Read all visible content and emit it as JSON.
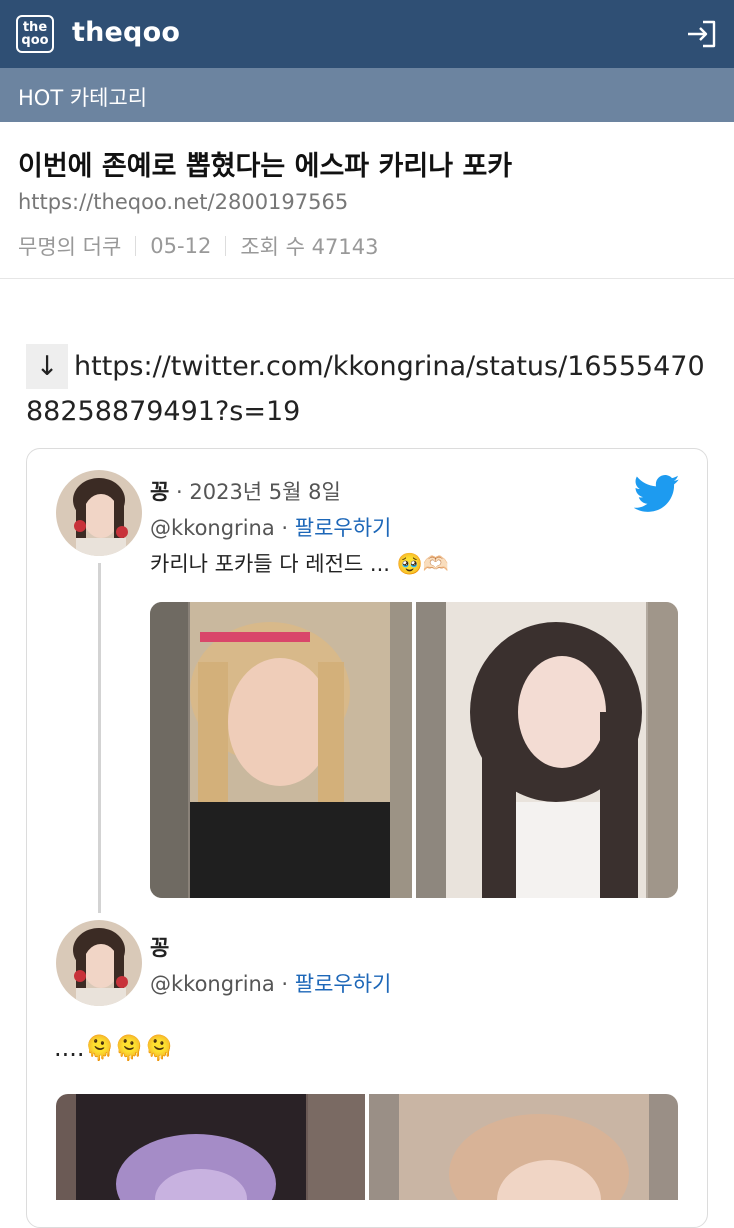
{
  "header": {
    "logo_top": "the",
    "logo_bottom": "qoo",
    "brand": "theqoo"
  },
  "category": {
    "label": "HOT 카테고리"
  },
  "post": {
    "title": "이번에 존예로 뽑혔다는 에스파 카리나 포카",
    "url": "https://theqoo.net/2800197565",
    "author": "무명의 더쿠",
    "date": "05-12",
    "views": "조회 수 47143"
  },
  "content": {
    "arrow": "↓",
    "link": "https://twitter.com/kkongrina/status/1655547088258879491?s=19"
  },
  "tweets": [
    {
      "name": "꽁",
      "date": "· 2023년 5월 8일",
      "handle": "@kkongrina",
      "dot": "·",
      "follow": "팔로우하기",
      "text": "카리나 포카들 다 레전드 ... 🥹🫶🏻"
    },
    {
      "name": "꽁",
      "handle": "@kkongrina",
      "dot": "·",
      "follow": "팔로우하기",
      "text": "....🫠🫠🫠"
    }
  ],
  "colors": {
    "header_bg": "#2f4f74",
    "category_bg": "#6c84a0",
    "link": "#1d67b8",
    "twitter": "#1d9bf0"
  }
}
